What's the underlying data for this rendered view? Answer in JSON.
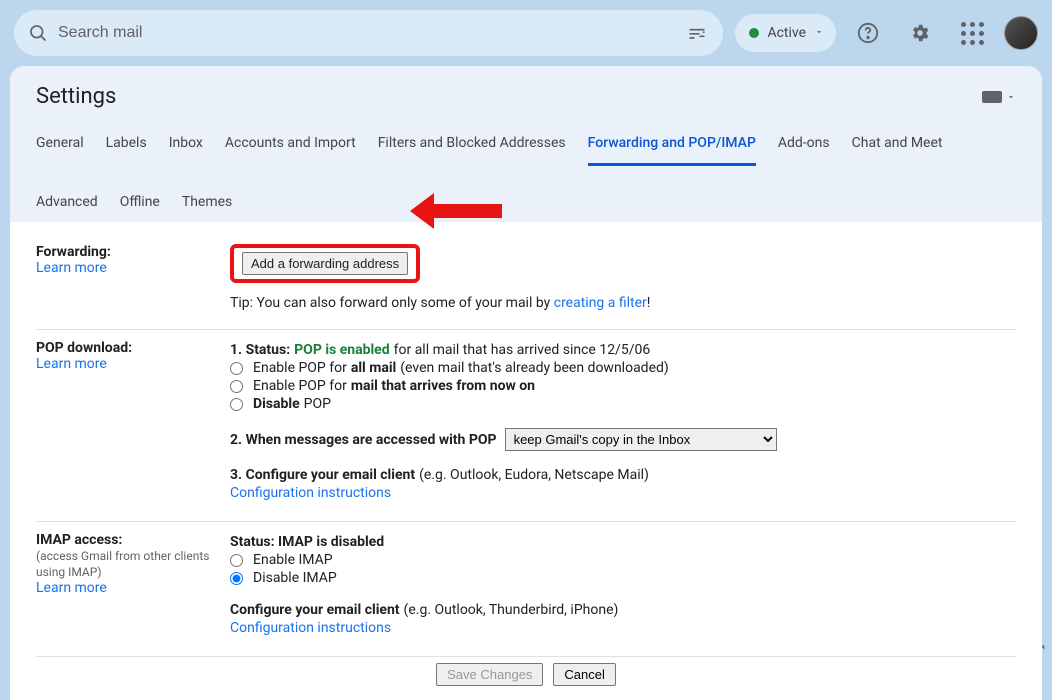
{
  "search": {
    "placeholder": "Search mail"
  },
  "status": {
    "label": "Active"
  },
  "page": {
    "title": "Settings"
  },
  "tabs": [
    {
      "label": "General",
      "active": false
    },
    {
      "label": "Labels",
      "active": false
    },
    {
      "label": "Inbox",
      "active": false
    },
    {
      "label": "Accounts and Import",
      "active": false
    },
    {
      "label": "Filters and Blocked Addresses",
      "active": false
    },
    {
      "label": "Forwarding and POP/IMAP",
      "active": true
    },
    {
      "label": "Add-ons",
      "active": false
    },
    {
      "label": "Chat and Meet",
      "active": false
    },
    {
      "label": "Advanced",
      "active": false
    },
    {
      "label": "Offline",
      "active": false
    },
    {
      "label": "Themes",
      "active": false
    }
  ],
  "forwarding": {
    "label": "Forwarding:",
    "learn": "Learn more",
    "button": "Add a forwarding address",
    "tip_prefix": "Tip: You can also forward only some of your mail by ",
    "tip_link": "creating a filter",
    "tip_suffix": "!"
  },
  "pop": {
    "label": "POP download:",
    "learn": "Learn more",
    "status_prefix": "1. Status: ",
    "status_value": "POP is enabled",
    "status_suffix": " for all mail that has arrived since 12/5/06",
    "opt1_prefix": "Enable POP for ",
    "opt1_bold": "all mail",
    "opt1_suffix": " (even mail that's already been downloaded)",
    "opt2_prefix": "Enable POP for ",
    "opt2_bold": "mail that arrives from now on",
    "opt3_prefix": "Disable",
    "opt3_suffix": " POP",
    "line2": "2. When messages are accessed with POP",
    "select_value": "keep Gmail's copy in the Inbox",
    "line3_bold": "3. Configure your email client",
    "line3_suffix": " (e.g. Outlook, Eudora, Netscape Mail)",
    "config_link": "Configuration instructions"
  },
  "imap": {
    "label": "IMAP access:",
    "sub": "(access Gmail from other clients using IMAP)",
    "learn": "Learn more",
    "status": "Status: IMAP is disabled",
    "opt1": "Enable IMAP",
    "opt2": "Disable IMAP",
    "config_bold": "Configure your email client",
    "config_suffix": " (e.g. Outlook, Thunderbird, iPhone)",
    "config_link": "Configuration instructions"
  },
  "footer": {
    "save": "Save Changes",
    "cancel": "Cancel"
  }
}
